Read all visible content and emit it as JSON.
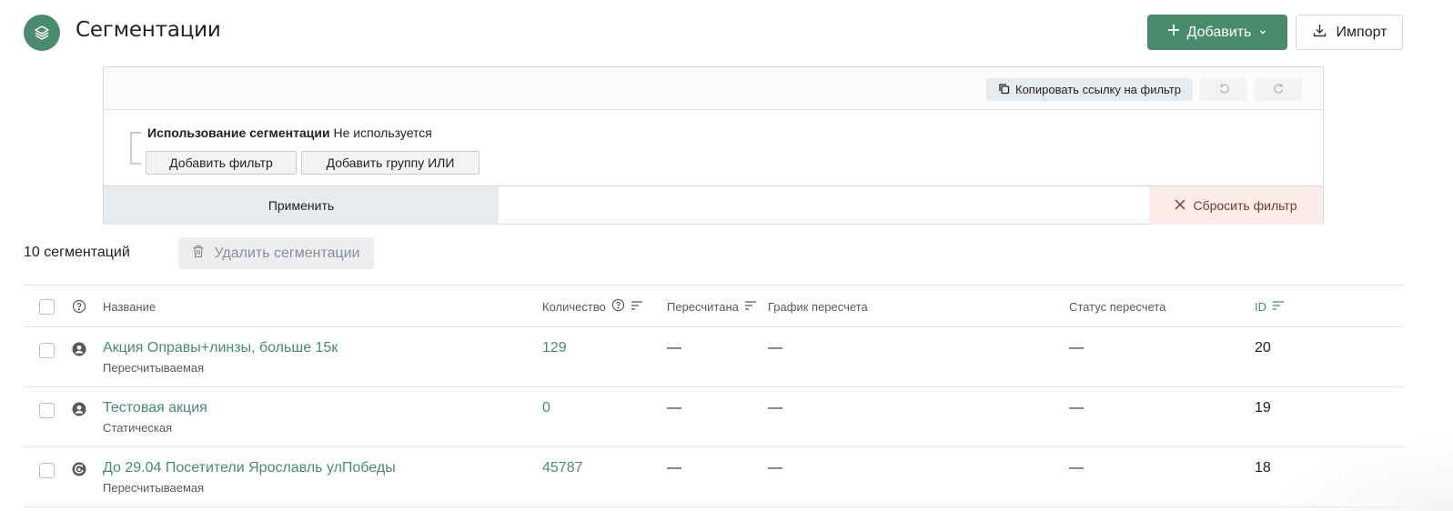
{
  "header": {
    "title": "Сегментации",
    "add_label": "Добавить",
    "import_label": "Импорт"
  },
  "filter": {
    "copy_link_label": "Копировать ссылку на фильтр",
    "condition_label": "Использование сегментации",
    "condition_value": "Не используется",
    "add_filter_label": "Добавить фильтр",
    "add_or_group_label": "Добавить группу ИЛИ",
    "apply_label": "Применить",
    "reset_label": "Сбросить фильтр"
  },
  "summary": {
    "count_text": "10 сегментаций",
    "delete_label": "Удалить сегментации"
  },
  "table": {
    "columns": {
      "name": "Название",
      "count": "Количество",
      "recalculated": "Пересчитана",
      "schedule": "График пересчета",
      "status": "Статус пересчета",
      "id": "ID"
    },
    "rows": [
      {
        "name": "Акция Оправы+линзы, больше 15к",
        "type": "Пересчитываемая",
        "count": "129",
        "recalculated": "—",
        "schedule": "—",
        "status": "—",
        "id": "20",
        "icon": "user-icon"
      },
      {
        "name": "Тестовая акция",
        "type": "Статическая",
        "count": "0",
        "recalculated": "—",
        "schedule": "—",
        "status": "—",
        "id": "19",
        "icon": "user-icon"
      },
      {
        "name": "До 29.04 Посетители Ярославль улПобеды",
        "type": "Пересчитываемая",
        "count": "45787",
        "recalculated": "—",
        "schedule": "—",
        "status": "—",
        "id": "18",
        "icon": "refresh-user-icon"
      }
    ]
  },
  "colors": {
    "accent": "#4a8b6e",
    "reset_bg": "#fbece9",
    "reset_text": "#7a3a2e"
  }
}
